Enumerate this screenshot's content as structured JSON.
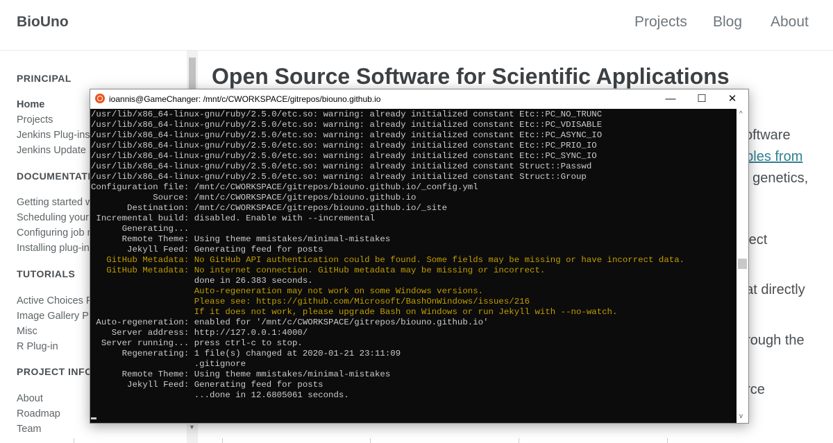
{
  "site": {
    "title": "BioUno",
    "nav": [
      "Projects",
      "Blog",
      "About"
    ]
  },
  "sidebar": {
    "sections": [
      {
        "heading": "PRINCIPAL",
        "links": [
          "Home",
          "Projects",
          "Jenkins Plug-ins",
          "Jenkins Update S"
        ]
      },
      {
        "heading": "DOCUMENTATI",
        "links": [
          "Getting started w",
          "Scheduling your",
          "Configuring job r",
          "Installing plug-in"
        ]
      },
      {
        "heading": "TUTORIALS",
        "links": [
          "Active Choices P",
          "Image Gallery Plu",
          "Misc",
          "R Plug-in"
        ]
      },
      {
        "heading": "PROJECT INFOR",
        "links": [
          "About",
          "Roadmap",
          "Team"
        ]
      }
    ]
  },
  "main": {
    "title": "Open Source Software for Scientific Applications",
    "fragments": [
      "software",
      "ables from",
      "s, genetics,",
      "oject",
      "hat directly",
      "hrough the",
      "urce"
    ]
  },
  "terminal": {
    "title": "ioannis@GameChanger: /mnt/c/CWORKSPACE/gitrepos/biouno.github.io",
    "lines": [
      {
        "text": "/usr/lib/x86_64-linux-gnu/ruby/2.5.0/etc.so: warning: already initialized constant Etc::PC_NO_TRUNC",
        "style": "normal"
      },
      {
        "text": "/usr/lib/x86_64-linux-gnu/ruby/2.5.0/etc.so: warning: already initialized constant Etc::PC_VDISABLE",
        "style": "normal"
      },
      {
        "text": "/usr/lib/x86_64-linux-gnu/ruby/2.5.0/etc.so: warning: already initialized constant Etc::PC_ASYNC_IO",
        "style": "normal"
      },
      {
        "text": "/usr/lib/x86_64-linux-gnu/ruby/2.5.0/etc.so: warning: already initialized constant Etc::PC_PRIO_IO",
        "style": "normal"
      },
      {
        "text": "/usr/lib/x86_64-linux-gnu/ruby/2.5.0/etc.so: warning: already initialized constant Etc::PC_SYNC_IO",
        "style": "normal"
      },
      {
        "text": "/usr/lib/x86_64-linux-gnu/ruby/2.5.0/etc.so: warning: already initialized constant Struct::Passwd",
        "style": "normal"
      },
      {
        "text": "/usr/lib/x86_64-linux-gnu/ruby/2.5.0/etc.so: warning: already initialized constant Struct::Group",
        "style": "normal"
      },
      {
        "text": "Configuration file: /mnt/c/CWORKSPACE/gitrepos/biouno.github.io/_config.yml",
        "style": "normal"
      },
      {
        "text": "            Source: /mnt/c/CWORKSPACE/gitrepos/biouno.github.io",
        "style": "normal"
      },
      {
        "text": "       Destination: /mnt/c/CWORKSPACE/gitrepos/biouno.github.io/_site",
        "style": "normal"
      },
      {
        "text": " Incremental build: disabled. Enable with --incremental",
        "style": "normal"
      },
      {
        "text": "      Generating...",
        "style": "normal"
      },
      {
        "text": "      Remote Theme: Using theme mmistakes/minimal-mistakes",
        "style": "normal"
      },
      {
        "text": "       Jekyll Feed: Generating feed for posts",
        "style": "normal"
      },
      {
        "text": "   GitHub Metadata: No GitHub API authentication could be found. Some fields may be missing or have incorrect data.",
        "style": "warn"
      },
      {
        "text": "   GitHub Metadata: No internet connection. GitHub metadata may be missing or incorrect.",
        "style": "warn"
      },
      {
        "text": "                    done in 26.383 seconds.",
        "style": "normal"
      },
      {
        "text": "                    Auto-regeneration may not work on some Windows versions.",
        "style": "warn"
      },
      {
        "text": "                    Please see: https://github.com/Microsoft/BashOnWindows/issues/216",
        "style": "warn"
      },
      {
        "text": "                    If it does not work, please upgrade Bash on Windows or run Jekyll with --no-watch.",
        "style": "warn"
      },
      {
        "text": " Auto-regeneration: enabled for '/mnt/c/CWORKSPACE/gitrepos/biouno.github.io'",
        "style": "normal"
      },
      {
        "text": "    Server address: http://127.0.0.1:4000/",
        "style": "normal"
      },
      {
        "text": "  Server running... press ctrl-c to stop.",
        "style": "normal"
      },
      {
        "text": "      Regenerating: 1 file(s) changed at 2020-01-21 23:11:09",
        "style": "normal"
      },
      {
        "text": "                    .gitignore",
        "style": "normal"
      },
      {
        "text": "      Remote Theme: Using theme mmistakes/minimal-mistakes",
        "style": "normal"
      },
      {
        "text": "       Jekyll Feed: Generating feed for posts",
        "style": "normal"
      },
      {
        "text": "                    ...done in 12.6805061 seconds.",
        "style": "normal"
      }
    ]
  },
  "colors": {
    "terminal_bg": "#0c0c0c",
    "terminal_text": "#cccccc",
    "terminal_warning": "#c19c00",
    "link": "#2f7f93",
    "ubuntu_orange": "#e95420"
  }
}
